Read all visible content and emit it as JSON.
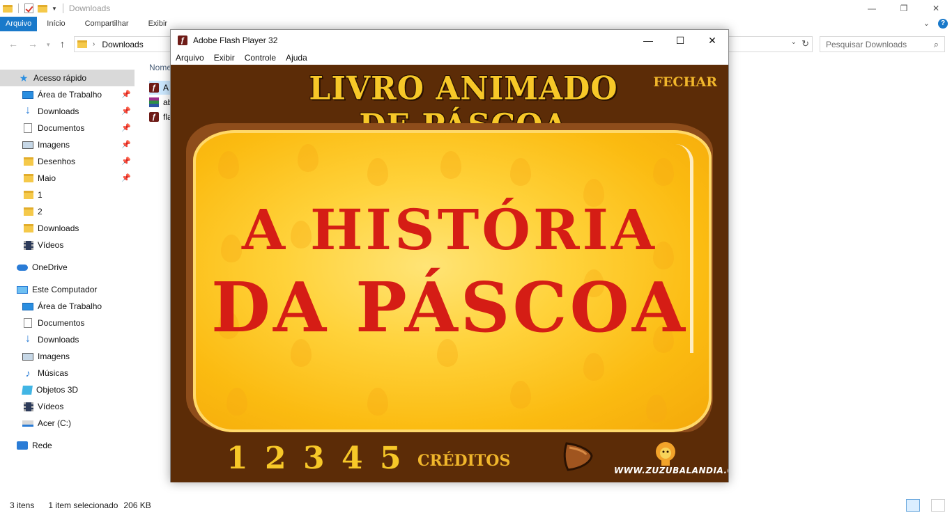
{
  "explorer": {
    "window_title": "Downloads",
    "ribbon_tabs": [
      "Arquivo",
      "Início",
      "Compartilhar",
      "Exibir"
    ],
    "address": "Downloads",
    "search_placeholder": "Pesquisar Downloads",
    "column_header": "Nome",
    "nav": {
      "quick_access": "Acesso rápido",
      "quick_items": [
        "Área de Trabalho",
        "Downloads",
        "Documentos",
        "Imagens",
        "Desenhos",
        "Maio",
        "1",
        "2",
        "Downloads",
        "Vídeos"
      ],
      "onedrive": "OneDrive",
      "this_pc": "Este Computador",
      "pc_items": [
        "Área de Trabalho",
        "Documentos",
        "Downloads",
        "Imagens",
        "Músicas",
        "Objetos 3D",
        "Vídeos",
        "Acer (C:)"
      ],
      "network": "Rede"
    },
    "files": [
      "A",
      "ab",
      "fla"
    ],
    "status": {
      "count": "3 itens",
      "selected": "1 item selecionado",
      "size": "206 KB"
    }
  },
  "flash": {
    "window_title": "Adobe Flash Player 32",
    "menu": [
      "Arquivo",
      "Exibir",
      "Controle",
      "Ajuda"
    ],
    "stage": {
      "title": "LIVRO ANIMADO DE PÁSCOA",
      "close_label": "FECHAR",
      "headline_line1": "A HISTÓRIA",
      "headline_line2": "DA PÁSCOA",
      "pages": [
        "1",
        "2",
        "3",
        "4",
        "5"
      ],
      "credits_label": "CRÉDITOS",
      "site": "WWW.ZUZUBALANDIA.COM.BR"
    }
  },
  "colors": {
    "accent": "#1979ca",
    "stage_bg": "#5c2c07",
    "title_gold": "#f7c828",
    "headline_red": "#d51d15"
  }
}
